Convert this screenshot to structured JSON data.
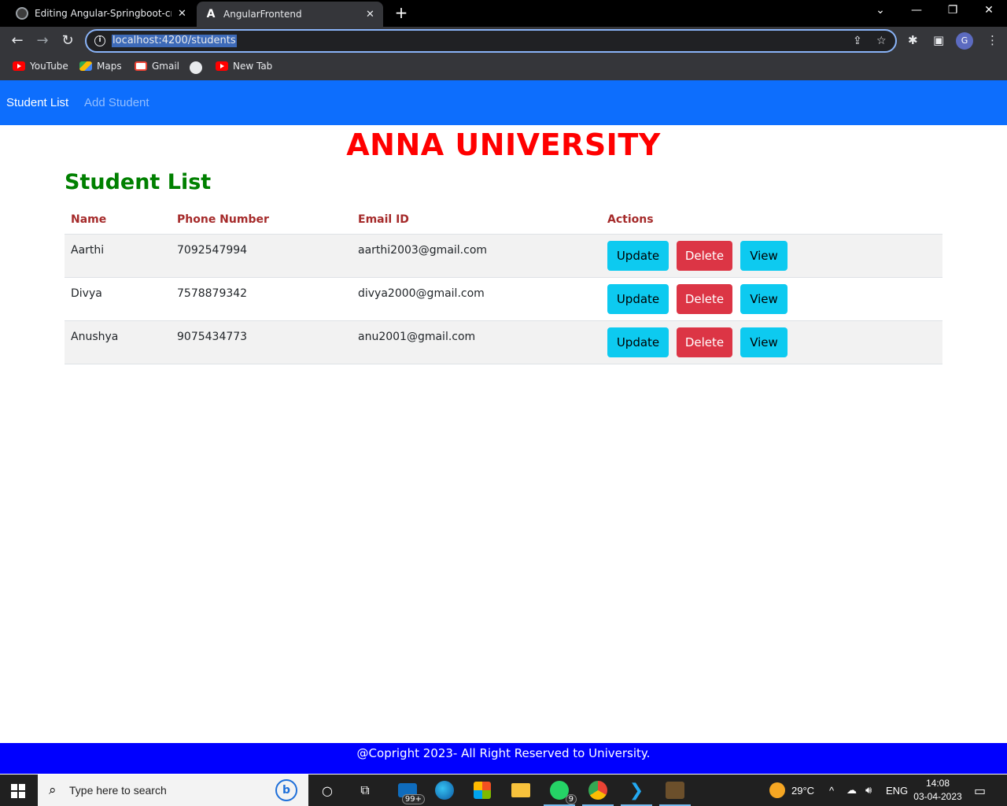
{
  "browser": {
    "tabs": [
      {
        "title": "Editing Angular-Springboot-crud",
        "active": false
      },
      {
        "title": "AngularFrontend",
        "active": true
      }
    ],
    "url": "localhost:4200/students",
    "bookmarks": [
      {
        "label": "YouTube",
        "icon": "youtube-icon"
      },
      {
        "label": "Maps",
        "icon": "maps-icon"
      },
      {
        "label": "Gmail",
        "icon": "gmail-icon"
      },
      {
        "label": "",
        "icon": "globe-icon"
      },
      {
        "label": "New Tab",
        "icon": "youtube-icon"
      }
    ],
    "profile_initial": "G"
  },
  "navbar": {
    "links": [
      {
        "label": "Student List",
        "active": true
      },
      {
        "label": "Add Student",
        "active": false
      }
    ],
    "bg_color": "#0d6efd"
  },
  "page": {
    "title": "ANNA UNIVERSITY",
    "heading": "Student List",
    "title_color": "#ff0000",
    "heading_color": "#008000"
  },
  "table": {
    "headers": [
      "Name",
      "Phone Number",
      "Email ID",
      "Actions"
    ],
    "rows": [
      {
        "name": "Aarthi",
        "phone": "7092547994",
        "email": "aarthi2003@gmail.com"
      },
      {
        "name": "Divya",
        "phone": "7578879342",
        "email": "divya2000@gmail.com"
      },
      {
        "name": "Anushya",
        "phone": "9075434773",
        "email": "anu2001@gmail.com"
      }
    ],
    "actions": {
      "update": "Update",
      "delete": "Delete",
      "view": "View"
    }
  },
  "footer": {
    "text": "@Copright 2023- All Right Reserved to University.",
    "bg_color": "#0000ff"
  },
  "taskbar": {
    "search_placeholder": "Type here to search",
    "mail_badge": "99+",
    "whatsapp_badge": "9",
    "weather": "29°C",
    "language": "ENG",
    "time": "14:08",
    "date": "03-04-2023"
  }
}
